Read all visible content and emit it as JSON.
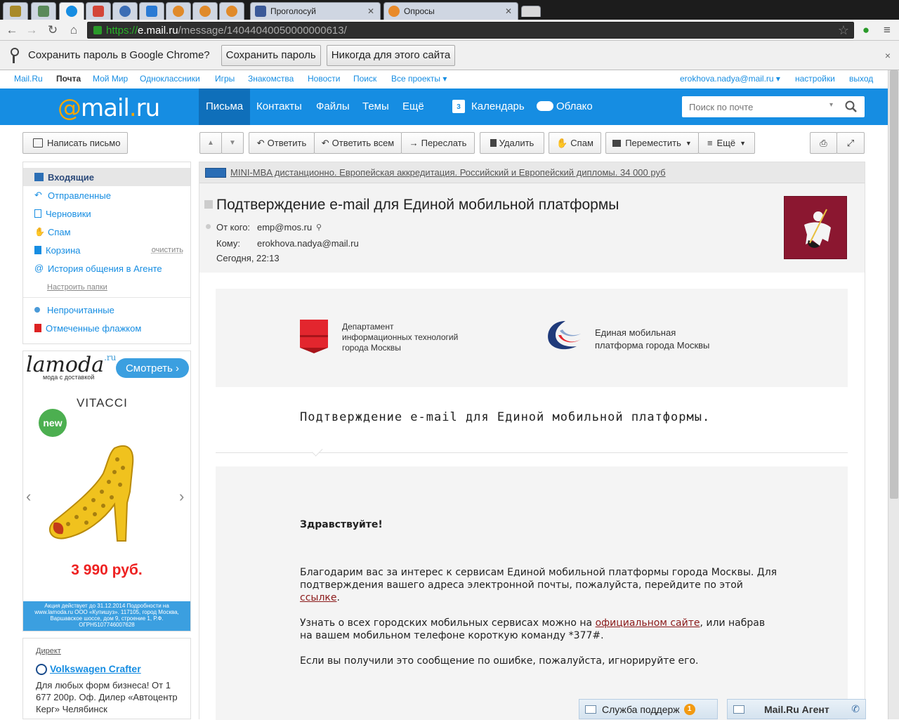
{
  "browser": {
    "tabs": [
      {
        "title": "",
        "color": "#a88a2a"
      },
      {
        "title": "",
        "color": "#5a8a5a"
      },
      {
        "title": "",
        "color": "#168de2"
      },
      {
        "title": "",
        "color": "#d44638"
      },
      {
        "title": "",
        "color": "#3b6db5"
      },
      {
        "title": "",
        "color": "#2a7ad4"
      },
      {
        "title": "",
        "color": "#e08a2a"
      },
      {
        "title": "",
        "color": "#e08a2a"
      },
      {
        "title": "",
        "color": "#e08a2a"
      },
      {
        "title": "Проголосуй",
        "color": "#3b5998"
      },
      {
        "title": "Опросы",
        "color": "#e88a2a"
      }
    ],
    "url": {
      "scheme": "https://",
      "host": "e.mail.ru",
      "path": "/message/14044040050000000613/"
    },
    "infobar": {
      "text": "Сохранить пароль в Google Chrome?",
      "save_label": "Сохранить пароль",
      "never_label": "Никогда для этого сайта",
      "close": "×"
    }
  },
  "portal": {
    "links": [
      "Mail.Ru",
      "Почта",
      "Мой Мир",
      "Одноклассники",
      "Игры",
      "Знакомства",
      "Новости",
      "Поиск",
      "Все проекты ▾"
    ],
    "user": "erokhova.nadya@mail.ru ▾",
    "settings": "настройки",
    "logout": "выход"
  },
  "header": {
    "logo_at": "@",
    "logo_mail": "mail",
    "logo_dot": ".",
    "logo_ru": "ru",
    "nav": [
      "Письма",
      "Контакты",
      "Файлы",
      "Темы",
      "Ещё"
    ],
    "calendar": "Календарь",
    "calendar_day": "3",
    "cloud": "Облако",
    "search_placeholder": "Поиск по почте"
  },
  "sidebar": {
    "compose": "Написать письмо",
    "folders": [
      {
        "label": "Входящие",
        "icon": "inbox-icon"
      },
      {
        "label": "Отправленные",
        "icon": "sent-icon"
      },
      {
        "label": "Черновики",
        "icon": "drafts-icon"
      },
      {
        "label": "Спам",
        "icon": "spam-icon"
      },
      {
        "label": "Корзина",
        "icon": "trash-icon"
      },
      {
        "label": "История общения в Агенте",
        "icon": "agent-icon"
      }
    ],
    "clear": "очистить",
    "configure": "Настроить папки",
    "filters": [
      {
        "label": "Непрочитанные",
        "icon": "unread-dot-icon"
      },
      {
        "label": "Отмеченные флажком",
        "icon": "flag-icon"
      }
    ]
  },
  "ad": {
    "brand_logo": "lamoda",
    "brand_ru": ".ru",
    "tagline": "мода с доставкой",
    "cta": "Смотреть ›",
    "product_brand": "VITACCI",
    "badge": "new",
    "price": "3 990 руб.",
    "fine_print": "Акция действует до 31.12.2014 Подробности на www.lamoda.ru ООО «Купишуз». 117105, город Москва, Варшавское шоссе, дом 9, строение 1, Р.Ф. ОГРН5107746007628"
  },
  "direct": {
    "label": "Директ",
    "title": "Volkswagen Crafter",
    "text": "Для любых форм бизнеса! От 1 677 200р. Оф. Дилер «Автоцентр Керг» Челябинск"
  },
  "toolbar": {
    "up": "▲",
    "down": "▼",
    "reply": "Ответить",
    "reply_all": "Ответить всем",
    "forward": "Переслать",
    "delete": "Удалить",
    "spam": "Спам",
    "move": "Переместить",
    "more": "Ещё"
  },
  "message": {
    "promo": "MINI-MBA дистанционно. Европейская аккредитация. Российский и Европейский дипломы. 34 000 руб",
    "subject": "Подтверждение e-mail для Единой мобильной платформы",
    "from_label": "От кого:",
    "from": "emp@mos.ru",
    "to_label": "Кому:",
    "to": "erokhova.nadya@mail.ru",
    "date": "Сегодня, 22:13",
    "org_left": [
      "Департамент",
      "информационных технологий",
      "города Москвы"
    ],
    "org_right": [
      "Единая мобильная",
      "платформа города Москвы"
    ],
    "title": "Подтверждение e-mail для Единой мобильной платформы.",
    "greeting": "Здравствуйте!",
    "p1_before": "Благодарим вас за интерес к сервисам Единой мобильной платформы города Москвы. Для подтверждения вашего адреса электронной почты, пожалуйста, перейдите по этой ",
    "p1_link": "ссылке",
    "p1_after": ".",
    "p2_before": "Узнать о всех городских мобильных сервисах можно на ",
    "p2_link": "официальном сайте",
    "p2_after": ", или набрав на вашем мобильном телефоне короткую команду *377#.",
    "p3": "Если вы получили это сообщение по ошибке, пожалуйста, игнорируйте его."
  },
  "bottom": {
    "support": "Служба поддерж",
    "support_badge": "1",
    "agent": "Mail.Ru Агент"
  }
}
